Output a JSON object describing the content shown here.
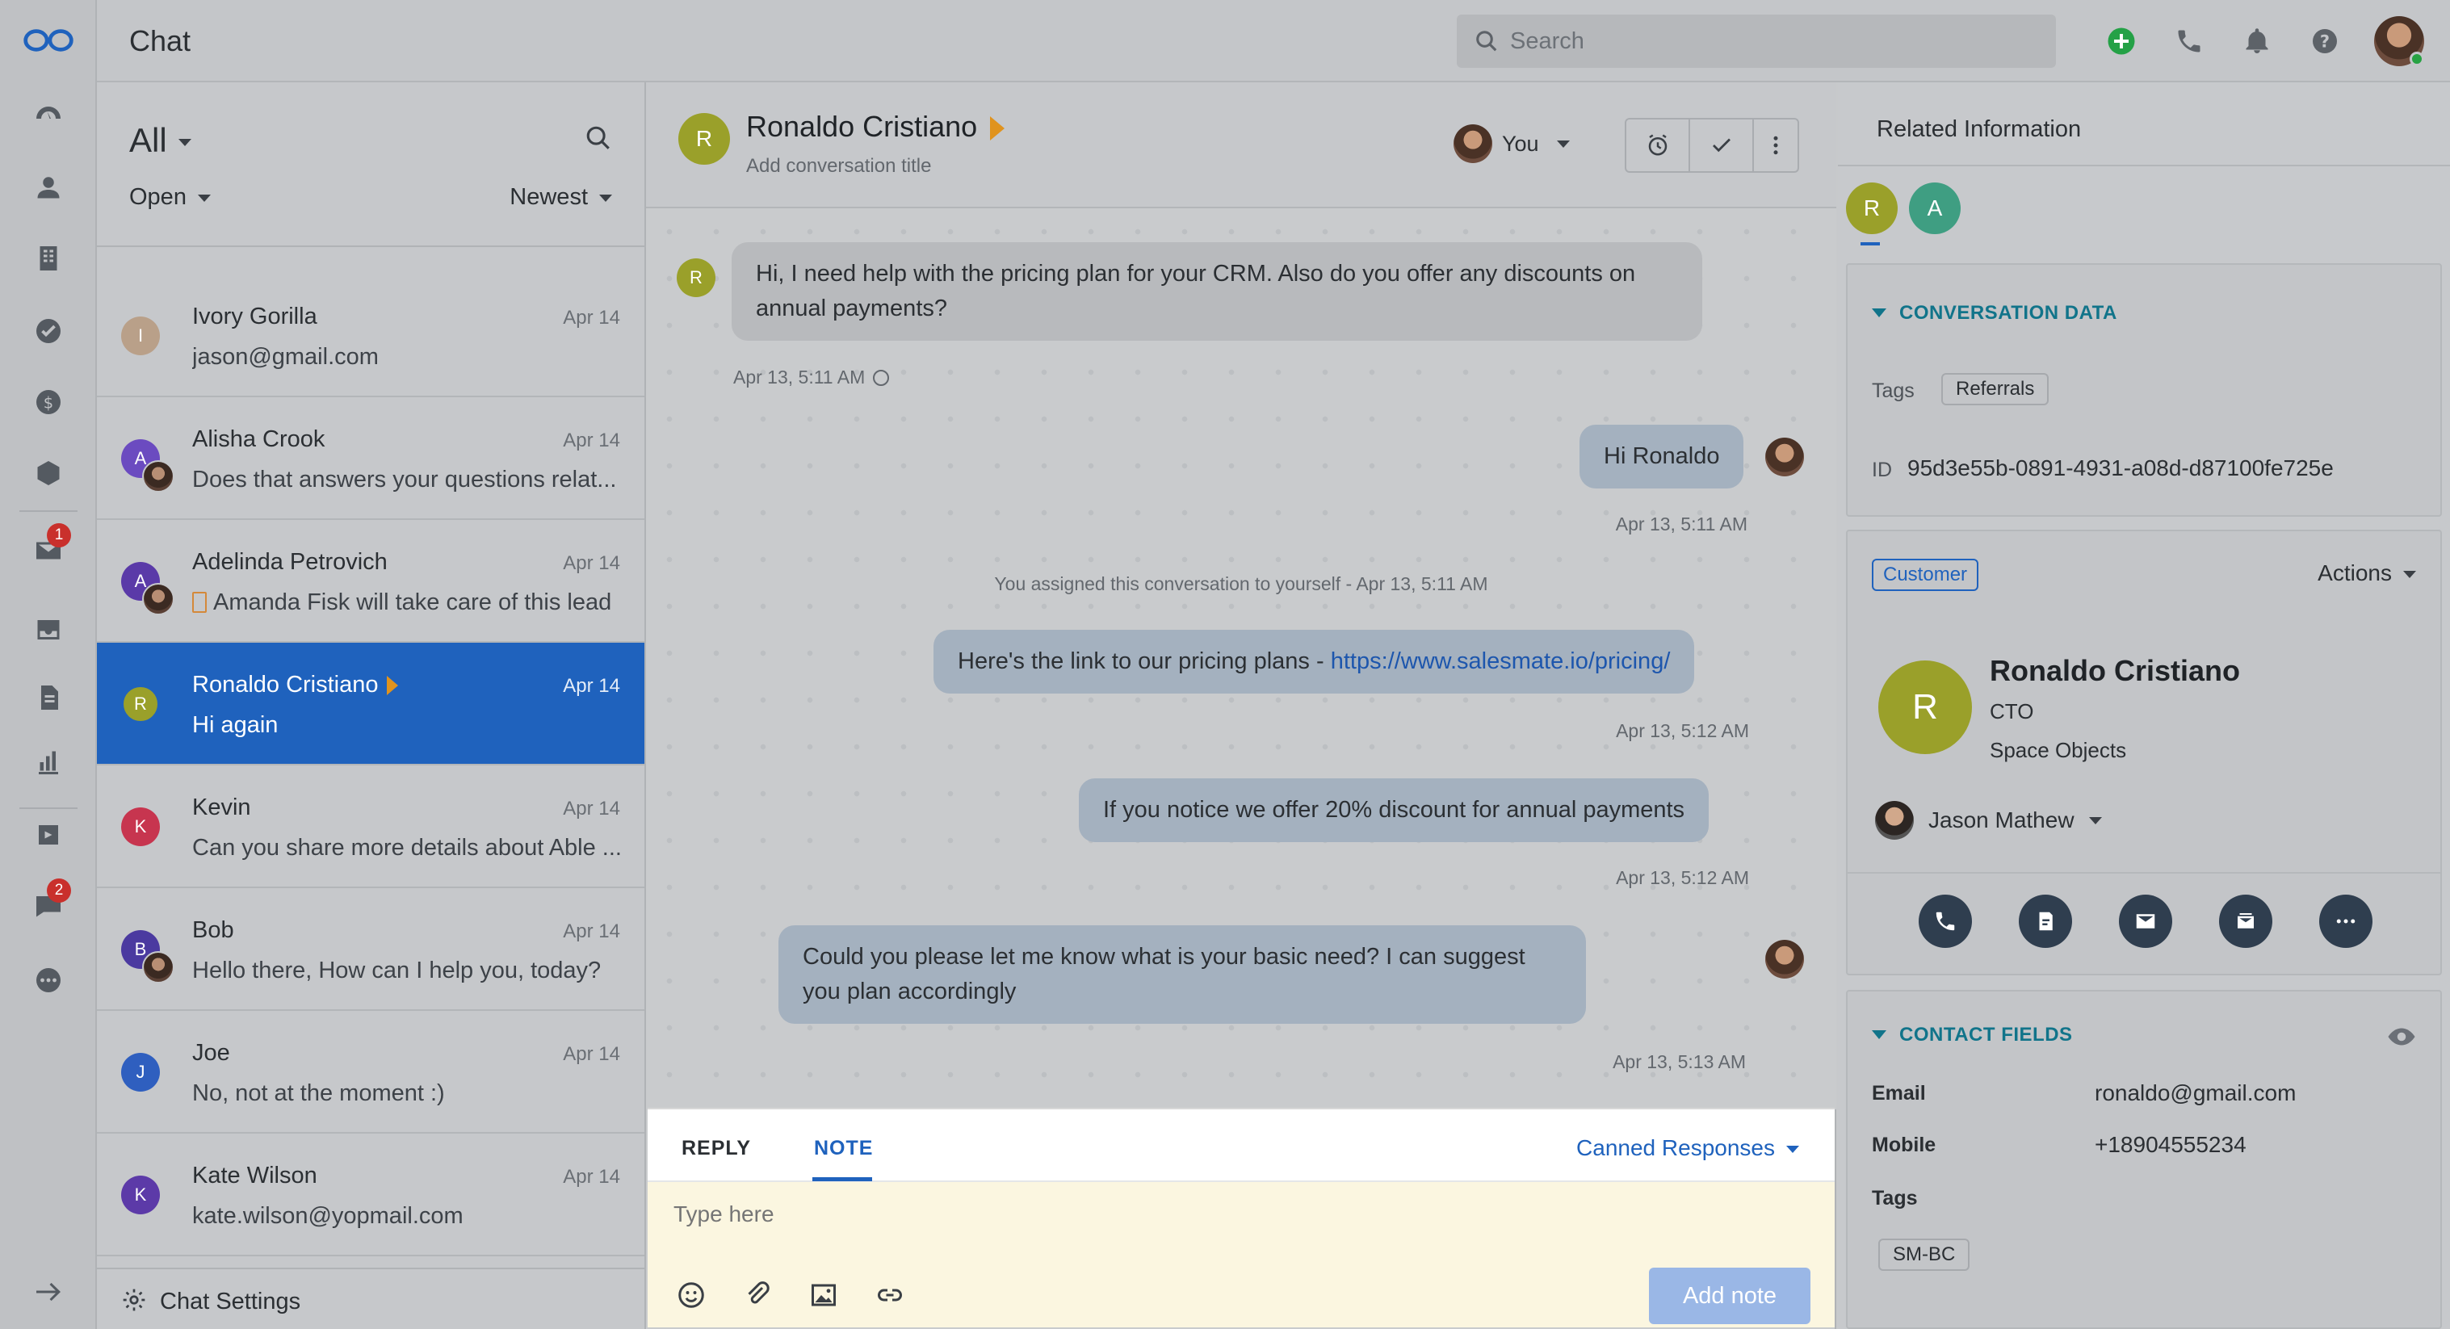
{
  "app": {
    "title": "Chat",
    "search_placeholder": "Search"
  },
  "rail": {
    "items": [
      {
        "icon": "dashboard-icon"
      },
      {
        "icon": "contacts-icon"
      },
      {
        "icon": "companies-icon"
      },
      {
        "icon": "tasks-icon"
      },
      {
        "icon": "deals-icon"
      },
      {
        "icon": "products-icon"
      },
      {
        "icon": "email-icon",
        "badge": "1"
      },
      {
        "icon": "inbox-icon"
      },
      {
        "icon": "documents-icon"
      },
      {
        "icon": "reports-icon"
      },
      {
        "icon": "automation-icon"
      },
      {
        "icon": "chat-icon",
        "badge": "2"
      },
      {
        "icon": "more-icon"
      }
    ]
  },
  "list": {
    "filter": "All",
    "status": "Open",
    "sort": "Newest",
    "settings_label": "Chat Settings",
    "conversations": [
      {
        "initial": "I",
        "color": "#b9a089",
        "name": "Ivory Gorilla",
        "date": "Apr 14",
        "snippet": "jason@gmail.com"
      },
      {
        "initial": "A",
        "color": "#6b4bc0",
        "name": "Alisha Crook",
        "date": "Apr 14",
        "snippet": "Does that answers your questions relat..."
      },
      {
        "initial": "A",
        "color": "#5a3aa8",
        "name": "Adelinda Petrovich",
        "date": "Apr 14",
        "snippet": "Amanda Fisk will take care of this lead"
      },
      {
        "initial": "R",
        "color": "#9aa02a",
        "name": "Ronaldo Cristiano",
        "date": "Apr 14",
        "snippet": "Hi again"
      },
      {
        "initial": "K",
        "color": "#c7354f",
        "name": "Kevin",
        "date": "Apr 14",
        "snippet": "Can you share more details about Able ..."
      },
      {
        "initial": "B",
        "color": "#4b3aa0",
        "name": "Bob",
        "date": "Apr 14",
        "snippet": "Hello there, How can I help you, today?"
      },
      {
        "initial": "J",
        "color": "#2f5fbf",
        "name": "Joe",
        "date": "Apr 14",
        "snippet": "No, not at the moment :)"
      },
      {
        "initial": "K",
        "color": "#5c3aa8",
        "name": "Kate Wilson",
        "date": "Apr 14",
        "snippet": "kate.wilson@yopmail.com"
      }
    ]
  },
  "conversation": {
    "initial": "R",
    "name": "Ronaldo Cristiano",
    "subtitle": "Add conversation title",
    "assignee": "You",
    "messages": [
      {
        "text": "Hi, I need help with the pricing plan for your CRM. Also do you offer any discounts on annual payments?",
        "time": "Apr 13, 5:11 AM",
        "avatar_initial": "R"
      },
      {
        "text": "Hi Ronaldo",
        "time": "Apr 13, 5:11 AM"
      },
      {
        "text": "Here's the link to our pricing plans - ",
        "link": "https://www.salesmate.io/pricing/",
        "time": "Apr 13, 5:12 AM"
      },
      {
        "text": "If you notice we offer 20% discount for annual payments",
        "time": "Apr 13, 5:12 AM"
      },
      {
        "text": "Could you please let me know what is your basic need? I can suggest you plan accordingly",
        "time": "Apr 13, 5:13 AM"
      }
    ],
    "system_message": "You assigned this conversation to yourself - Apr 13, 5:11 AM"
  },
  "composer": {
    "tab_reply": "REPLY",
    "tab_note": "NOTE",
    "canned": "Canned Responses",
    "placeholder": "Type here",
    "add_note": "Add note"
  },
  "right": {
    "title": "Related Information",
    "avatars": [
      {
        "initial": "R",
        "color": "#9aa02a"
      },
      {
        "initial": "A",
        "color": "#3f9e82"
      }
    ],
    "conversation_data": {
      "heading": "CONVERSATION DATA",
      "tags_label": "Tags",
      "tag": "Referrals",
      "id_label": "ID",
      "id_value": "95d3e55b-0891-4931-a08d-d87100fe725e"
    },
    "customer": {
      "badge": "Customer",
      "actions": "Actions",
      "initial": "R",
      "name": "Ronaldo Cristiano",
      "title": "CTO",
      "company": "Space Objects",
      "owner": "Jason Mathew"
    },
    "contact_fields": {
      "heading": "CONTACT FIELDS",
      "email_label": "Email",
      "email": "ronaldo@gmail.com",
      "mobile_label": "Mobile",
      "mobile": "+18904555234",
      "tags_label": "Tags",
      "tag": "SM-BC"
    }
  }
}
